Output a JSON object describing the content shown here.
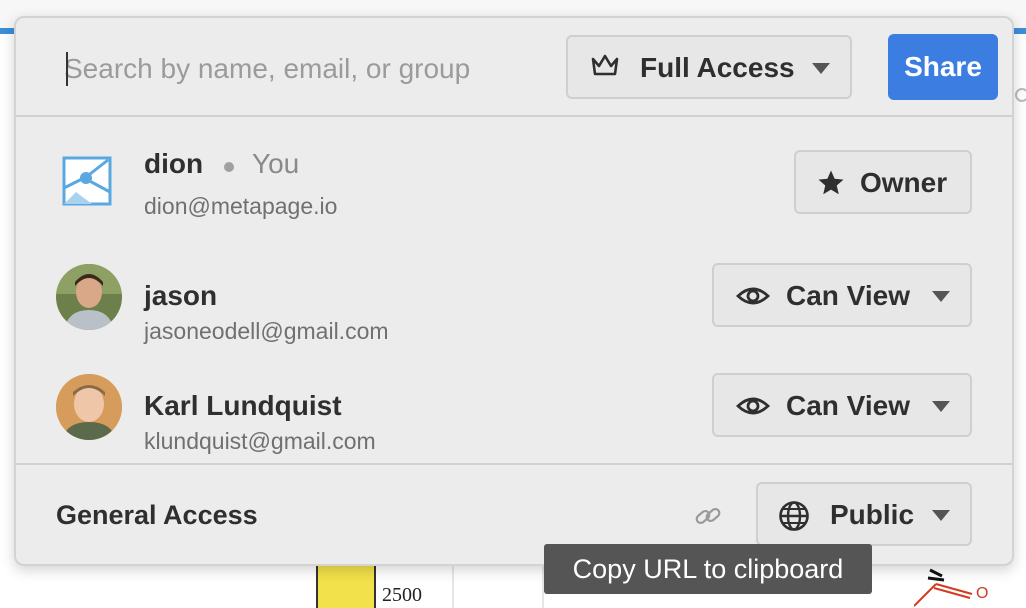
{
  "search": {
    "placeholder": "Search by name, email, or group",
    "value": ""
  },
  "access_selector": {
    "label": "Full Access",
    "icon": "crown-icon"
  },
  "share_button": {
    "label": "Share",
    "color": "#3b7de0"
  },
  "members": [
    {
      "name": "dion",
      "you_label": "You",
      "email": "dion@metapage.io",
      "role": "Owner",
      "role_icon": "star-icon",
      "avatar": "metapage-logo"
    },
    {
      "name": "jason",
      "email": "jasoneodell@gmail.com",
      "role": "Can View",
      "role_icon": "eye-icon",
      "avatar": "photo"
    },
    {
      "name": "Karl Lundquist",
      "email": "klundquist@gmail.com",
      "role": "Can View",
      "role_icon": "eye-icon",
      "avatar": "photo"
    }
  ],
  "general_access": {
    "label": "General Access",
    "value": "Public",
    "icon": "globe-icon",
    "link_icon": "link-icon"
  },
  "tooltip": {
    "text": "Copy URL to clipboard"
  },
  "background": {
    "bar_label": "2500",
    "node_label": "O"
  }
}
